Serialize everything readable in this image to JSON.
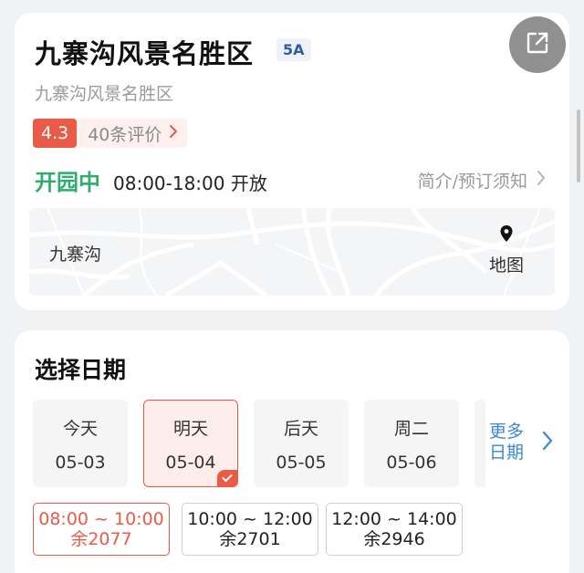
{
  "attraction": {
    "name": "九寨沟风景名胜区",
    "grade": "5A",
    "subtitle": "九寨沟风景名胜区",
    "rating": {
      "score": "4.3",
      "count_label": "40条评价"
    },
    "status": "开园中",
    "hours": "08:00-18:00 开放",
    "intro_link": "简介/预订须知",
    "map": {
      "location": "九寨沟",
      "button_label": "地图"
    }
  },
  "date_picker": {
    "title": "选择日期",
    "dates": [
      {
        "day": "今天",
        "date": "05-03",
        "selected": false
      },
      {
        "day": "明天",
        "date": "05-04",
        "selected": true
      },
      {
        "day": "后天",
        "date": "05-05",
        "selected": false
      },
      {
        "day": "周二",
        "date": "05-06",
        "selected": false
      }
    ],
    "more_label": "更多日期",
    "more_line1": "更多",
    "more_line2": "日期"
  },
  "time_slots": [
    {
      "time": "08:00 ~ 10:00",
      "remaining": "余2077",
      "selected": true
    },
    {
      "time": "10:00 ~ 12:00",
      "remaining": "余2701",
      "selected": false
    },
    {
      "time": "12:00 ~ 14:00",
      "remaining": "余2946",
      "selected": false
    }
  ],
  "colors": {
    "accent_red": "#e95b46",
    "open_green": "#2fae6b",
    "link_blue": "#3a87d8",
    "grade_blue": "#2f5e9c"
  },
  "icons": {
    "share": "share-icon",
    "map_pin": "map-pin-icon",
    "chevron": "chevron-right-icon",
    "check": "check-icon"
  }
}
